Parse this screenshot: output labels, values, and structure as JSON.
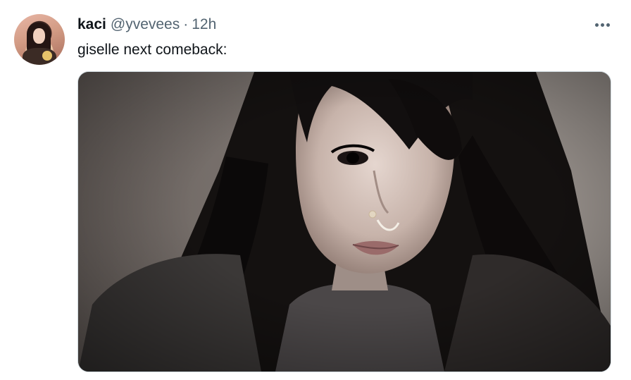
{
  "tweet": {
    "author_name": "kaci",
    "author_handle": "@yvevees",
    "separator": "·",
    "timestamp": "12h",
    "text": "giselle next comeback:"
  },
  "icons": {
    "more": "more-horizontal-icon",
    "avatar": "profile-avatar"
  },
  "colors": {
    "primary_text": "#0f1419",
    "secondary_text": "#536471",
    "border": "#cfd9de"
  }
}
